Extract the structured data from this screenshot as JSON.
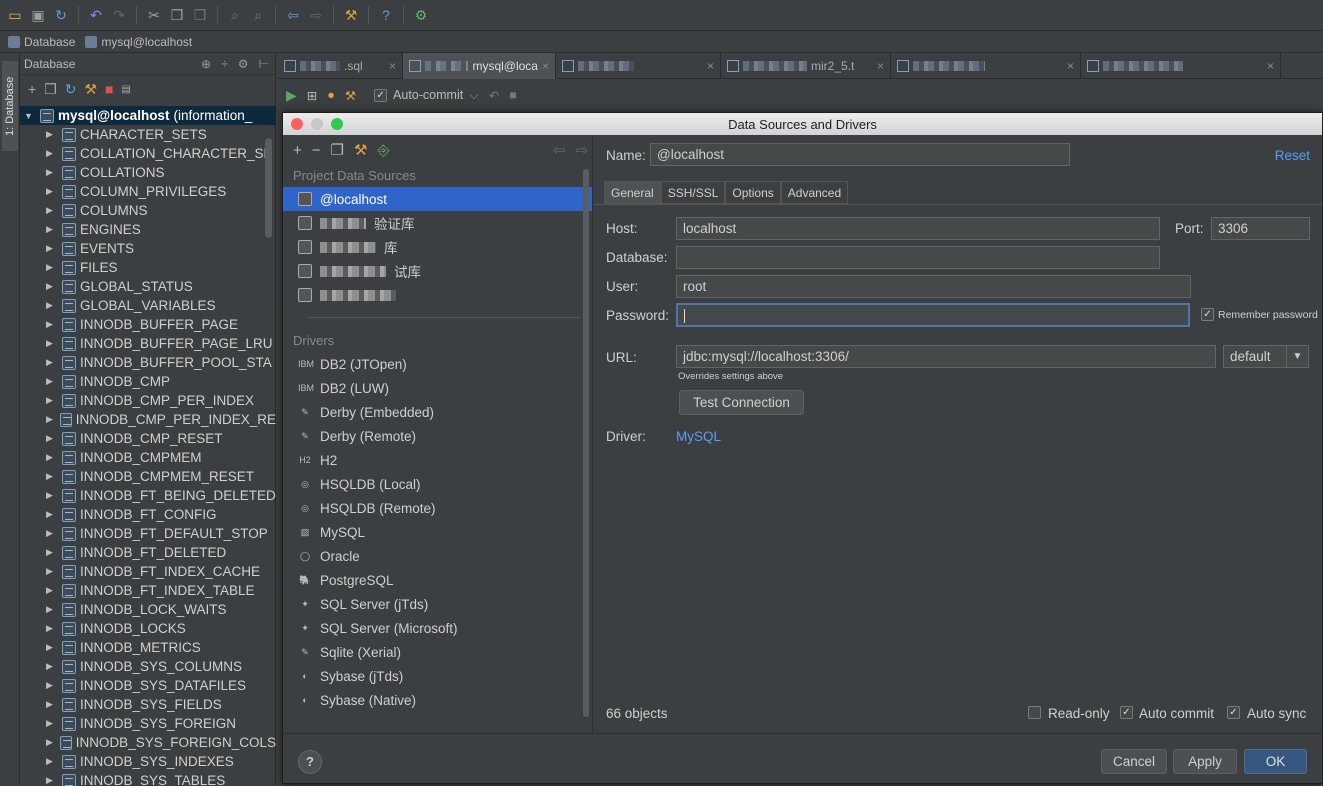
{
  "breadcrumbs": [
    "Database",
    "mysql@localhost"
  ],
  "side_strip_label": "1: Database",
  "db_panel": {
    "title": "Database",
    "root_label": "mysql@localhost",
    "root_suffix": "(information_",
    "tables": [
      "CHARACTER_SETS",
      "COLLATION_CHARACTER_SE",
      "COLLATIONS",
      "COLUMN_PRIVILEGES",
      "COLUMNS",
      "ENGINES",
      "EVENTS",
      "FILES",
      "GLOBAL_STATUS",
      "GLOBAL_VARIABLES",
      "INNODB_BUFFER_PAGE",
      "INNODB_BUFFER_PAGE_LRU",
      "INNODB_BUFFER_POOL_STA",
      "INNODB_CMP",
      "INNODB_CMP_PER_INDEX",
      "INNODB_CMP_PER_INDEX_RE",
      "INNODB_CMP_RESET",
      "INNODB_CMPMEM",
      "INNODB_CMPMEM_RESET",
      "INNODB_FT_BEING_DELETED",
      "INNODB_FT_CONFIG",
      "INNODB_FT_DEFAULT_STOP",
      "INNODB_FT_DELETED",
      "INNODB_FT_INDEX_CACHE",
      "INNODB_FT_INDEX_TABLE",
      "INNODB_LOCK_WAITS",
      "INNODB_LOCKS",
      "INNODB_METRICS",
      "INNODB_SYS_COLUMNS",
      "INNODB_SYS_DATAFILES",
      "INNODB_SYS_FIELDS",
      "INNODB_SYS_FOREIGN",
      "INNODB_SYS_FOREIGN_COLS",
      "INNODB_SYS_INDEXES",
      "INNODB_SYS_TABLES"
    ]
  },
  "editor_tabs": [
    {
      "suffix": ".sql",
      "active": false
    },
    {
      "suffix": "mysql@loca",
      "active": true
    },
    {
      "suffix": "",
      "active": false
    },
    {
      "suffix": "mir2_5.t",
      "active": false
    },
    {
      "suffix": "",
      "active": false
    },
    {
      "suffix": "",
      "active": false
    }
  ],
  "editor_toolbar": {
    "auto_commit_label": "Auto-commit"
  },
  "dialog": {
    "title": "Data Sources and Drivers",
    "project_sources_header": "Project Data Sources",
    "data_sources": [
      {
        "label": "@localhost",
        "selected": true
      },
      {
        "label": "验证库",
        "blurred_prefix": true
      },
      {
        "label": "库",
        "blurred_prefix": true,
        "blur_mid": "广"
      },
      {
        "label": "试库",
        "blurred_prefix": true
      },
      {
        "label": "",
        "blurred_prefix": true
      }
    ],
    "drivers_header": "Drivers",
    "drivers": [
      {
        "label": "DB2 (JTOpen)",
        "icon": "ibm-icon"
      },
      {
        "label": "DB2 (LUW)",
        "icon": "ibm-icon"
      },
      {
        "label": "Derby (Embedded)",
        "icon": "feather-icon"
      },
      {
        "label": "Derby (Remote)",
        "icon": "feather-icon"
      },
      {
        "label": "H2",
        "icon": "h2-icon"
      },
      {
        "label": "HSQLDB (Local)",
        "icon": "hsqldb-icon"
      },
      {
        "label": "HSQLDB (Remote)",
        "icon": "hsqldb-icon"
      },
      {
        "label": "MySQL",
        "icon": "mysql-icon"
      },
      {
        "label": "Oracle",
        "icon": "oracle-icon"
      },
      {
        "label": "PostgreSQL",
        "icon": "elephant-icon"
      },
      {
        "label": "SQL Server (jTds)",
        "icon": "sqlserver-icon"
      },
      {
        "label": "SQL Server (Microsoft)",
        "icon": "sqlserver-icon"
      },
      {
        "label": "Sqlite (Xerial)",
        "icon": "feather-icon"
      },
      {
        "label": "Sybase (jTds)",
        "icon": "sybase-icon"
      },
      {
        "label": "Sybase (Native)",
        "icon": "sybase-icon"
      }
    ],
    "name_label": "Name:",
    "name_value": "@localhost",
    "reset_label": "Reset",
    "tabs": [
      "General",
      "SSH/SSL",
      "Options",
      "Advanced"
    ],
    "active_tab": "General",
    "host_label": "Host:",
    "host_value": "localhost",
    "port_label": "Port:",
    "port_value": "3306",
    "database_label": "Database:",
    "database_value": "",
    "user_label": "User:",
    "user_value": "root",
    "password_label": "Password:",
    "password_value": "",
    "remember_password_label": "Remember password",
    "url_label": "URL:",
    "url_value": "jdbc:mysql://localhost:3306/",
    "url_mode": "default",
    "url_hint": "Overrides settings above",
    "test_connection_label": "Test Connection",
    "driver_label": "Driver:",
    "driver_value": "MySQL",
    "objects_count": "66 objects",
    "readonly_label": "Read-only",
    "auto_commit_label": "Auto commit",
    "auto_sync_label": "Auto sync",
    "help_label": "?",
    "cancel_label": "Cancel",
    "apply_label": "Apply",
    "ok_label": "OK"
  },
  "colors": {
    "selection": "#2f65ca",
    "link": "#589df6",
    "close_light": "#fc605b",
    "min_light": "#c8c8c8",
    "max_light": "#34c84a"
  }
}
